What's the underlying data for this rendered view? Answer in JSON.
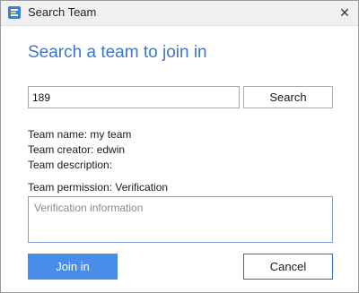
{
  "window": {
    "title": "Search Team",
    "app_icon": "app-logo-icon",
    "close_glyph": "✕"
  },
  "heading": "Search a team to join in",
  "search": {
    "value": "189",
    "button_label": "Search"
  },
  "team": {
    "name_line": "Team name: my team",
    "creator_line": "Team creator: edwin",
    "description_line": "Team description:",
    "permission_line": "Team permission: Verification"
  },
  "verification": {
    "placeholder": "Verification information"
  },
  "buttons": {
    "join": "Join in",
    "cancel": "Cancel"
  },
  "colors": {
    "accent": "#3f76c7",
    "primary_button": "#4a8de8",
    "cancel_border": "#2e6bbd"
  }
}
